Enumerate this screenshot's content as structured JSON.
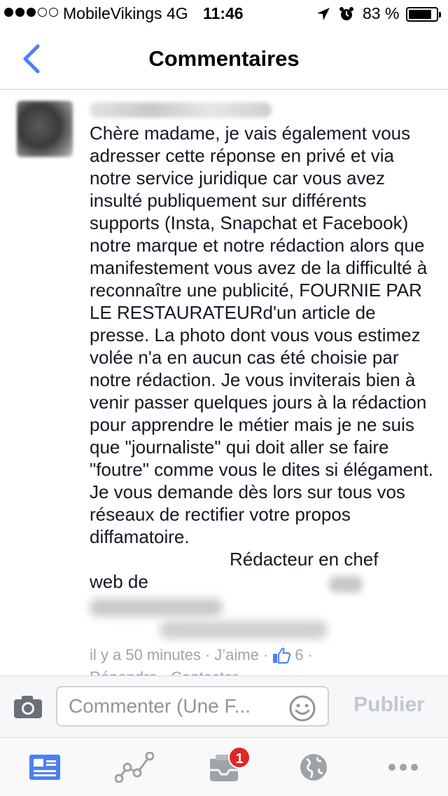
{
  "status_bar": {
    "carrier": "MobileVikings",
    "network": "4G",
    "time": "11:46",
    "battery_percent": "83 %",
    "signal_bars_filled": 3,
    "signal_bars_total": 5
  },
  "nav": {
    "back_icon": "chevron-left-icon",
    "title": "Commentaires"
  },
  "comment": {
    "text": "Chère madame, je vais également vous adresser cette réponse en privé et via notre service juridique car vous avez insulté publiquement sur différents supports (Insta, Snapchat et Facebook) notre marque et notre rédaction alors que manifestement vous avez de la difficulté à reconnaître une publicité, FOURNIE PAR LE RESTAURATEURd'un article de presse. La photo dont vous vous estimez volée n'a en aucun cas été choisie par notre rédaction.  Je vous inviterais bien à venir passer quelques jours à la rédaction pour apprendre le métier mais je ne suis que \"journaliste\" qui doit aller se faire \"foutre\" comme vous le dites si élégament. Je vous demande dès lors sur tous vos réseaux de rectifier votre propos diffamatoire.",
    "signature_visible": "Rédacteur en chef",
    "signature_line2_visible": "web de",
    "time_ago": "il y a 50 minutes",
    "like_label": "J’aime",
    "like_count": "6",
    "reply_label": "Répondre",
    "contact_label": "Contacter",
    "separator": "·"
  },
  "composer": {
    "placeholder": "Commenter (Une F...",
    "publish_label": "Publier"
  },
  "tab_bar": {
    "tabs": [
      {
        "icon": "news-feed-icon",
        "active": true
      },
      {
        "icon": "activity-graph-icon",
        "active": false
      },
      {
        "icon": "notifications-icon",
        "active": false,
        "badge": "1"
      },
      {
        "icon": "globe-icon",
        "active": false
      },
      {
        "icon": "more-icon",
        "active": false
      }
    ]
  },
  "colors": {
    "accent": "#4a80f5",
    "badge": "#e02626",
    "muted": "#a0a4ab"
  }
}
